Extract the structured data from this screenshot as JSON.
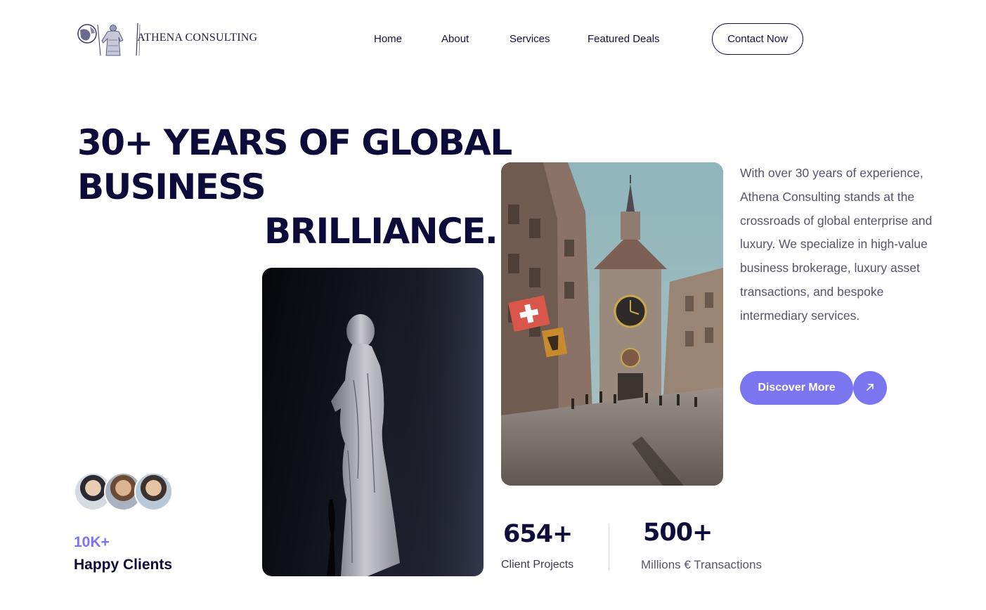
{
  "header": {
    "brand": "ATHENA CONSULTING",
    "nav": [
      "Home",
      "About",
      "Services",
      "Featured Deals"
    ],
    "contact_label": "Contact Now"
  },
  "hero": {
    "headline_line1": "30+ YEARS OF GLOBAL BUSINESS",
    "headline_line2": "BRILLIANCE.",
    "description": "With over 30 years of experience, Athena Consulting stands at the crossroads of global enterprise and luxury. We specialize in high-value business brokerage, luxury asset transactions, and bespoke intermediary services.",
    "cta_label": "Discover More",
    "cta_icon": "arrow-up-right-icon"
  },
  "clients": {
    "count": "10K+",
    "label": "Happy Clients"
  },
  "stats": [
    {
      "value": "654+",
      "label": "Client Projects"
    },
    {
      "value": "500+",
      "label": "Millions € Transactions"
    }
  ],
  "colors": {
    "navy": "#0c0b3a",
    "accent": "#7b75f0",
    "body_text": "#55546a"
  }
}
